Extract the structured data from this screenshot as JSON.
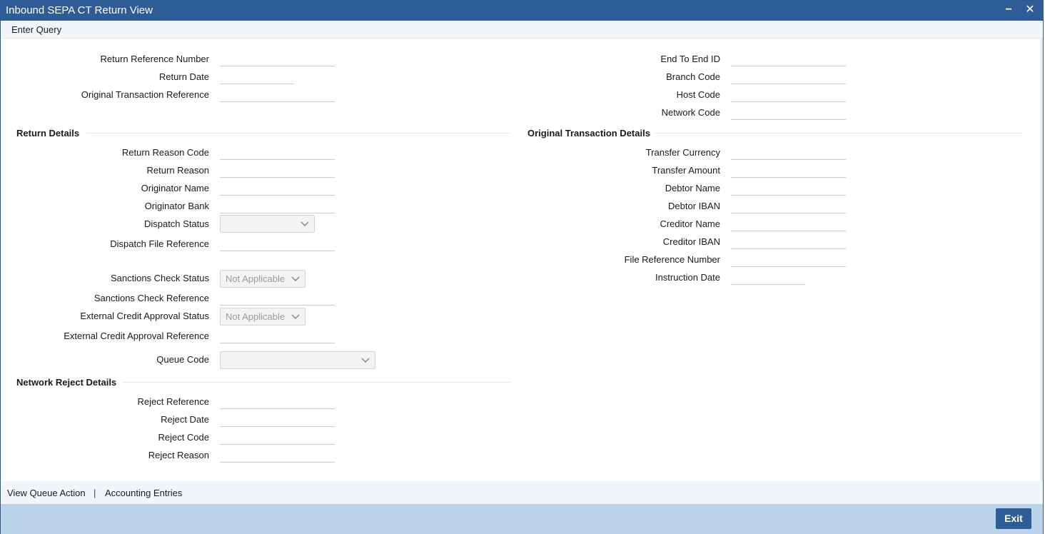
{
  "window": {
    "title": "Inbound SEPA CT Return View",
    "minimize_glyph": "−",
    "close_glyph": "✕"
  },
  "menu": {
    "enter_query": "Enter Query"
  },
  "header_left": {
    "return_reference_number": "Return Reference Number",
    "return_date": "Return Date",
    "original_transaction_reference": "Original Transaction Reference"
  },
  "header_right": {
    "end_to_end_id": "End To End ID",
    "branch_code": "Branch Code",
    "host_code": "Host Code",
    "network_code": "Network Code"
  },
  "return_details": {
    "title": "Return Details",
    "return_reason_code": "Return Reason Code",
    "return_reason": "Return Reason",
    "originator_name": "Originator Name",
    "originator_bank": "Originator Bank",
    "dispatch_status": "Dispatch Status",
    "dispatch_file_reference": "Dispatch File Reference",
    "sanctions_check_status": "Sanctions Check Status",
    "sanctions_check_status_value": "Not Applicable",
    "sanctions_check_reference": "Sanctions Check Reference",
    "external_credit_approval_status": "External Credit Approval Status",
    "external_credit_approval_status_value": "Not Applicable",
    "external_credit_approval_reference": "External Credit Approval Reference",
    "queue_code": "Queue Code"
  },
  "original_transaction_details": {
    "title": "Original Transaction Details",
    "transfer_currency": "Transfer Currency",
    "transfer_amount": "Transfer Amount",
    "debtor_name": "Debtor Name",
    "debtor_iban": "Debtor IBAN",
    "creditor_name": "Creditor Name",
    "creditor_iban": "Creditor IBAN",
    "file_reference_number": "File Reference Number",
    "instruction_date": "Instruction Date"
  },
  "network_reject_details": {
    "title": "Network Reject Details",
    "reject_reference": "Reject Reference",
    "reject_date": "Reject Date",
    "reject_code": "Reject Code",
    "reject_reason": "Reject Reason"
  },
  "footer": {
    "view_queue_action": "View Queue Action",
    "separator": "|",
    "accounting_entries": "Accounting Entries",
    "exit": "Exit"
  },
  "colors": {
    "titlebar": "#2e5c96",
    "footer_bar": "#bcd4ea",
    "menubar": "#f2f6fa"
  },
  "icons": {
    "dropdown": "chevron-down-icon",
    "minimize": "minimize-icon",
    "close": "close-icon"
  }
}
